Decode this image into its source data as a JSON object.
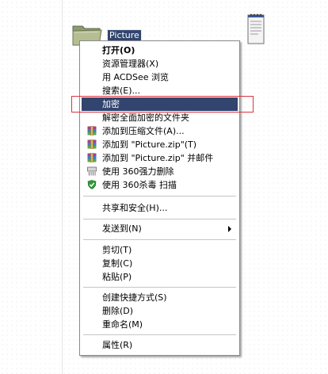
{
  "desktop": {
    "folder_label": "Picture"
  },
  "menu": {
    "items": [
      {
        "label": "打开(O)",
        "bold": true
      },
      {
        "label": "资源管理器(X)"
      },
      {
        "label": "用 ACDSee 浏览"
      },
      {
        "label": "搜索(E)..."
      },
      {
        "label": "加密",
        "selected": true
      },
      {
        "label": "解密全面加密的文件夹"
      },
      {
        "label": "添加到压缩文件(A)...",
        "icon": "winrar-archive-icon"
      },
      {
        "label": "添加到 \"Picture.zip\"(T)",
        "icon": "winrar-archive-icon"
      },
      {
        "label": "添加到 \"Picture.zip\" 并邮件",
        "icon": "winrar-archive-icon"
      },
      {
        "label": "使用 360强力删除",
        "icon": "shredder-icon"
      },
      {
        "label": "使用 360杀毒 扫描",
        "icon": "shield-check-icon"
      },
      {
        "label": "共享和安全(H)..."
      },
      {
        "label": "发送到(N)",
        "submenu": true
      },
      {
        "label": "剪切(T)"
      },
      {
        "label": "复制(C)"
      },
      {
        "label": "粘贴(P)"
      },
      {
        "label": "创建快捷方式(S)"
      },
      {
        "label": "删除(D)"
      },
      {
        "label": "重命名(M)"
      },
      {
        "label": "属性(R)"
      }
    ]
  },
  "colors": {
    "selection": "#31456e",
    "highlight_box": "#d9363e"
  }
}
